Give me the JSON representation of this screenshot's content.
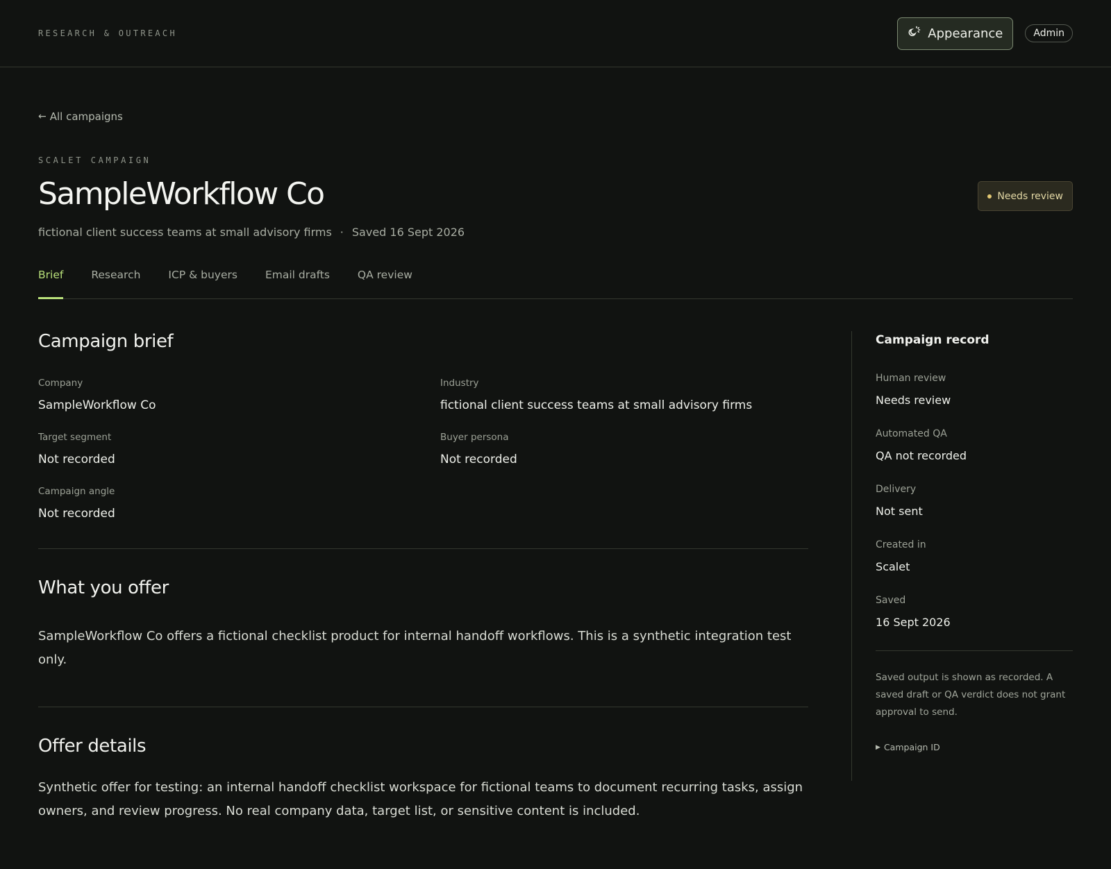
{
  "header": {
    "eyebrow": "RESEARCH & OUTREACH",
    "appearance_label": "Appearance",
    "admin_label": "Admin"
  },
  "back_link": {
    "label": "All campaigns"
  },
  "campaign": {
    "kicker": "SCALET CAMPAIGN",
    "title": "SampleWorkflow Co",
    "status": "Needs review",
    "industry": "fictional client success teams at small advisory firms",
    "separator": "·",
    "saved": "Saved 16 Sept 2026"
  },
  "tabs": [
    {
      "label": "Brief",
      "active": true
    },
    {
      "label": "Research"
    },
    {
      "label": "ICP & buyers"
    },
    {
      "label": "Email drafts"
    },
    {
      "label": "QA review"
    }
  ],
  "brief": {
    "title": "Campaign brief",
    "fields": [
      {
        "label": "Company",
        "value": "SampleWorkflow Co"
      },
      {
        "label": "Industry",
        "value": "fictional client success teams at small advisory firms"
      },
      {
        "label": "Target segment",
        "value": "Not recorded"
      },
      {
        "label": "Buyer persona",
        "value": "Not recorded"
      },
      {
        "label": "Campaign angle",
        "value": "Not recorded"
      }
    ]
  },
  "offer": {
    "title": "What you offer",
    "text": "SampleWorkflow Co offers a fictional checklist product for internal handoff workflows. This is a synthetic integration test only."
  },
  "offer_details": {
    "title": "Offer details",
    "text": "Synthetic offer for testing: an internal handoff checklist workspace for fictional teams to document recurring tasks, assign owners, and review progress. No real company data, target list, or sensitive content is included."
  },
  "record": {
    "title": "Campaign record",
    "items": [
      {
        "label": "Human review",
        "value": "Needs review"
      },
      {
        "label": "Automated QA",
        "value": "QA not recorded"
      },
      {
        "label": "Delivery",
        "value": "Not sent"
      },
      {
        "label": "Created in",
        "value": "Scalet"
      },
      {
        "label": "Saved",
        "value": "16 Sept 2026"
      }
    ],
    "note": "Saved output is shown as recorded. A saved draft or QA verdict does not grant approval to send.",
    "disclosure_label": "Campaign ID"
  },
  "colors": {
    "background": "#111311",
    "accent": "#b8e07a",
    "status_bg": "#2b2a1f",
    "status_text": "#e2d7a4"
  }
}
